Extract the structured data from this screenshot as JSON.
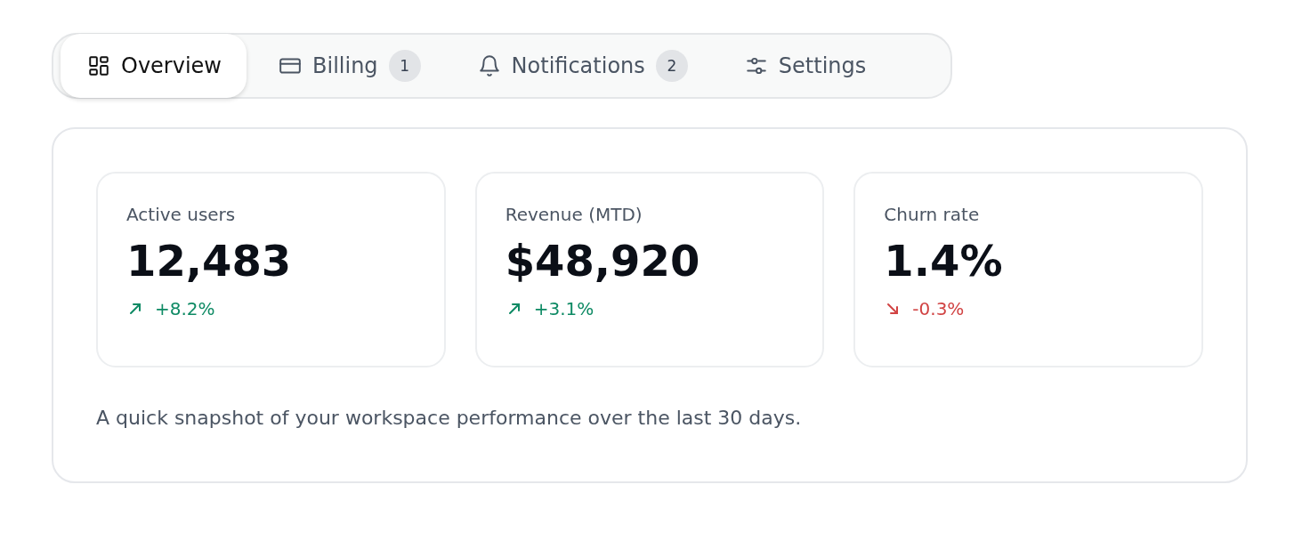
{
  "tabs": [
    {
      "kind": "overview",
      "label": "Overview",
      "selected": true
    },
    {
      "kind": "billing",
      "label": "Billing",
      "badge": "1",
      "selected": false
    },
    {
      "kind": "notifications",
      "label": "Notifications",
      "badge": "2",
      "selected": false
    },
    {
      "kind": "settings",
      "label": "Settings",
      "selected": false
    }
  ],
  "metrics": [
    {
      "label": "Active users",
      "value": "12,483",
      "change": "+8.2%",
      "kind": "up"
    },
    {
      "label": "Revenue (MTD)",
      "value": "$48,920",
      "change": "+3.1%",
      "kind": "up"
    },
    {
      "label": "Churn rate",
      "value": "1.4%",
      "change": "-0.3%",
      "kind": "down"
    }
  ],
  "caption": "A quick snapshot of your workspace performance over the last 30 days."
}
